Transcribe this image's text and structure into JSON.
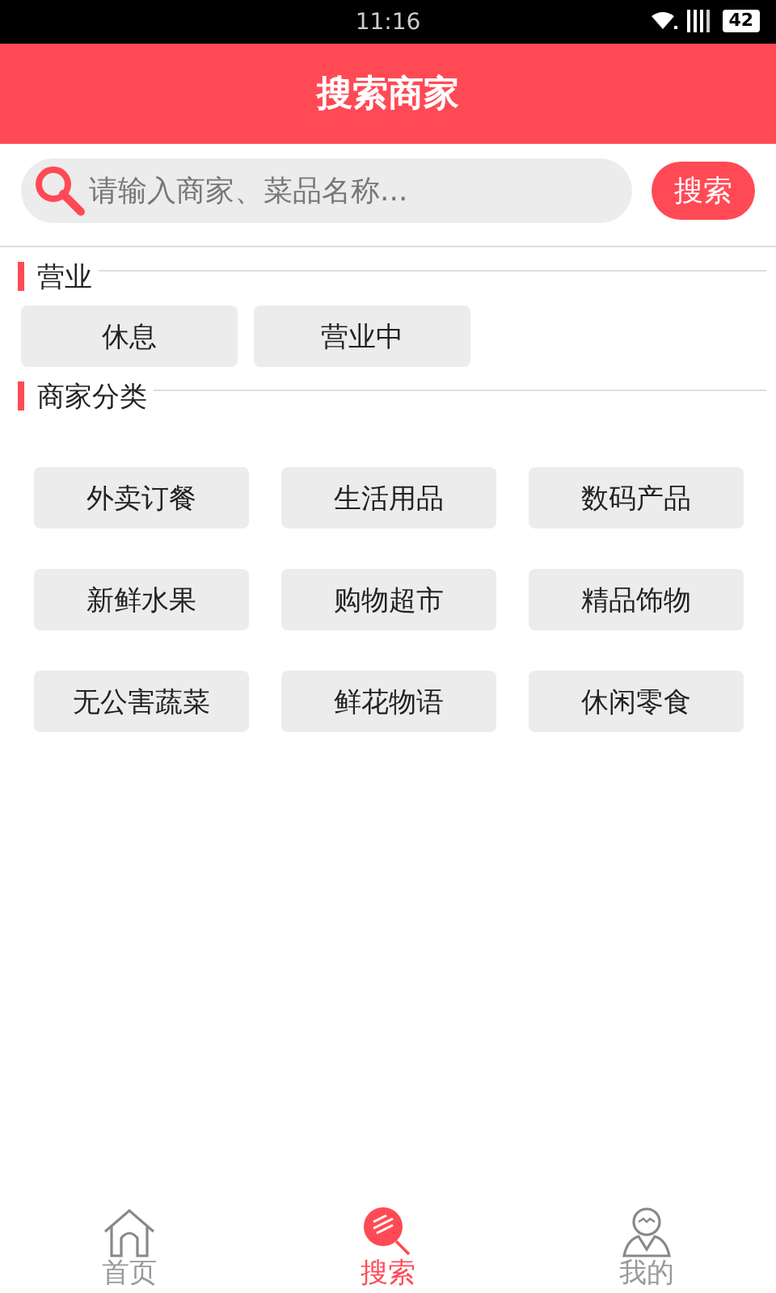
{
  "status_bar": {
    "time": "11:16",
    "battery": "42"
  },
  "header": {
    "title": "搜索商家"
  },
  "search": {
    "placeholder": "请输入商家、菜品名称...",
    "button": "搜索"
  },
  "sections": [
    {
      "title": "营业",
      "kind": "row",
      "options": [
        "休息",
        "营业中"
      ]
    },
    {
      "title": "商家分类",
      "kind": "grid",
      "options": [
        "外卖订餐",
        "生活用品",
        "数码产品",
        "新鲜水果",
        "购物超市",
        "精品饰物",
        "无公害蔬菜",
        "鲜花物语",
        "休闲零食"
      ]
    }
  ],
  "tabs": [
    {
      "kind": "home",
      "label": "首页",
      "selected": false
    },
    {
      "kind": "search",
      "label": "搜索",
      "selected": true
    },
    {
      "kind": "profile",
      "label": "我的",
      "selected": false
    }
  ]
}
